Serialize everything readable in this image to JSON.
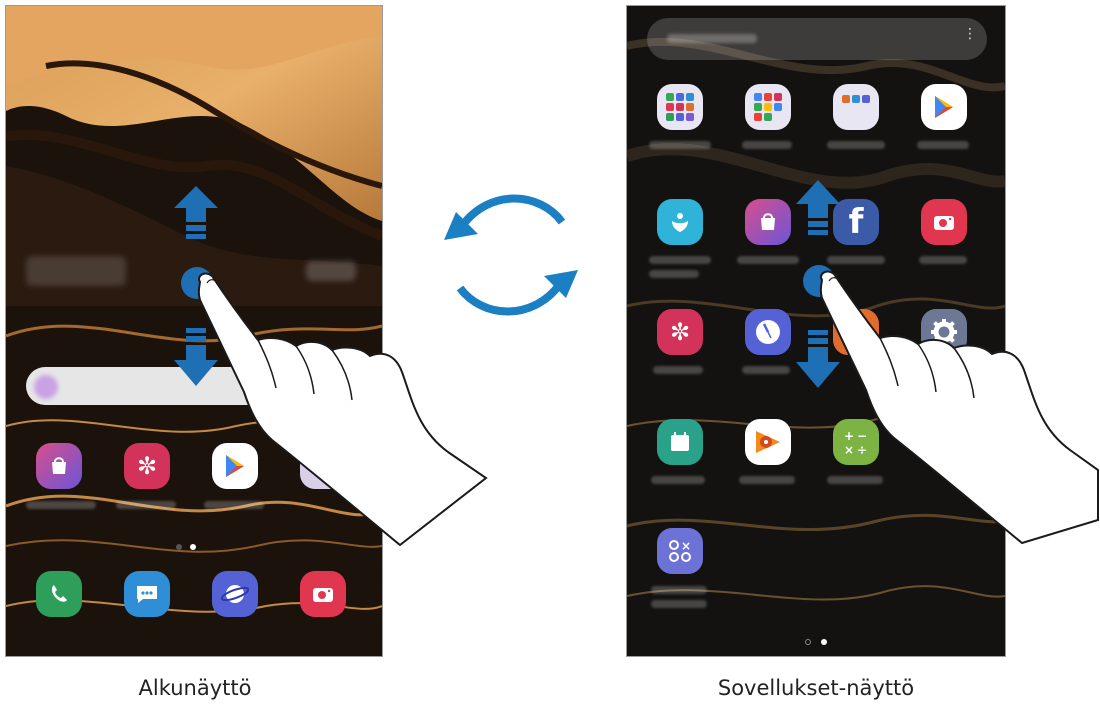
{
  "captions": {
    "home": "Alkunäyttö",
    "apps": "Sovellukset-näyttö"
  },
  "home_screen": {
    "dock_icons": [
      "phone-icon",
      "messages-icon",
      "internet-icon",
      "camera-icon"
    ],
    "app_icons": [
      "galaxy-store-icon",
      "gallery-icon",
      "play-store-icon"
    ]
  },
  "apps_screen": {
    "rows": [
      [
        "samsung-folder-icon",
        "google-folder-icon",
        "microsoft-folder-icon",
        "play-store-icon"
      ],
      [
        "samsung-members-icon",
        "galaxy-store-icon",
        "facebook-icon",
        "camera-icon"
      ],
      [
        "gallery-icon",
        "clock-icon",
        "orange-app-icon",
        "settings-icon"
      ],
      [
        "calendar-icon",
        "play-music-icon",
        "calculator-icon",
        ""
      ],
      [
        "samsung-notes-icon",
        "",
        "",
        ""
      ]
    ]
  },
  "colors": {
    "arrow": "#1e6fb3",
    "rotate_arrow": "#1b7fc4"
  }
}
